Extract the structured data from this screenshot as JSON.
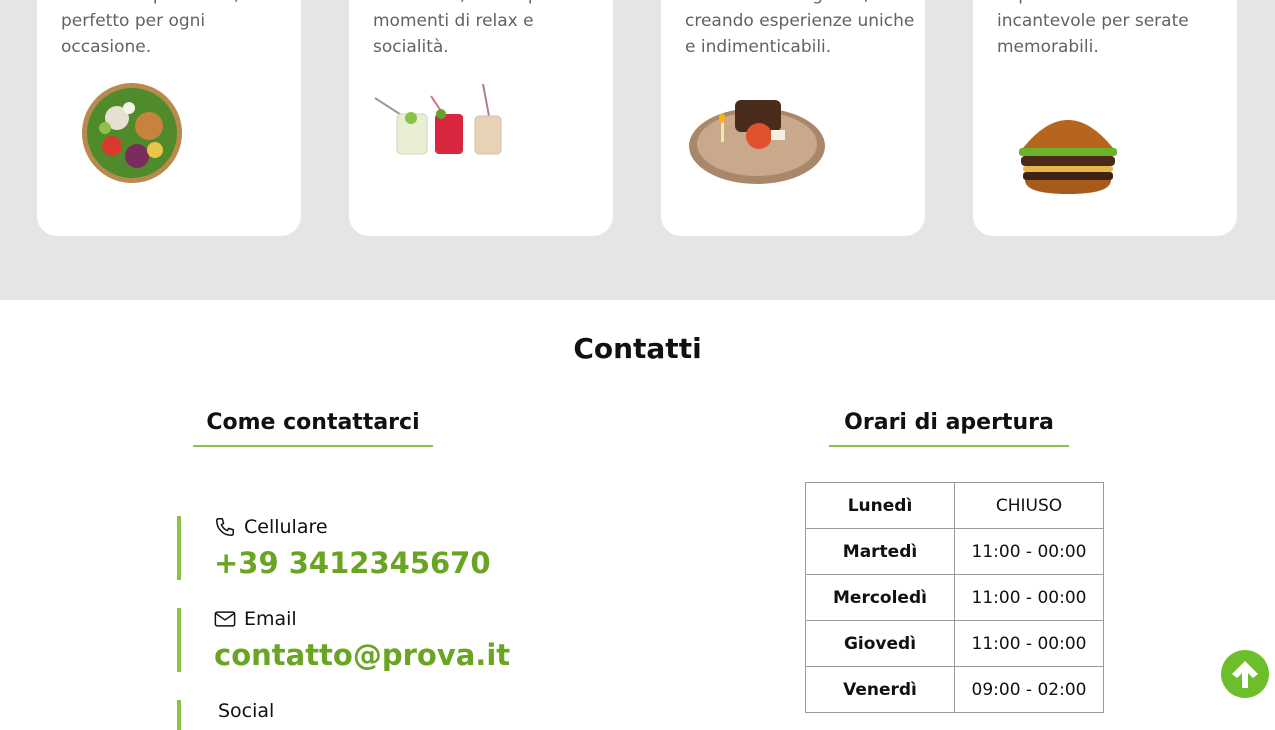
{
  "services": {
    "cards": [
      {
        "text": "servizio impeccabile, perfetto per ogni occasione.",
        "image": "salad-bowl"
      },
      {
        "text": "sofisticata, ideale per momenti di relax e socialità.",
        "image": "three-cocktails"
      },
      {
        "text": "attento alle esigenze, creando esperienze uniche e indimenticabili.",
        "image": "dessert-plate"
      },
      {
        "text": "impeccabile e ambiente incantevole per serate memorabili.",
        "image": "burger"
      }
    ]
  },
  "contacts": {
    "title": "Contatti",
    "how_to_contact": "Come contattarci",
    "phone_label": "Cellulare",
    "phone_value": "+39 3412345670",
    "email_label": "Email",
    "email_value": "contatto@prova.it",
    "social_label": "Social"
  },
  "hours": {
    "title": "Orari di apertura",
    "rows": [
      {
        "day": "Lunedì",
        "time": "CHIUSO"
      },
      {
        "day": "Martedì",
        "time": "11:00 - 00:00"
      },
      {
        "day": "Mercoledì",
        "time": "11:00 - 00:00"
      },
      {
        "day": "Giovedì",
        "time": "11:00 - 00:00"
      },
      {
        "day": "Venerdì",
        "time": "09:00 - 02:00"
      }
    ]
  },
  "colors": {
    "accent": "#8bc34a",
    "link_green": "#6aa423",
    "band_gray": "#e5e5e5",
    "scroll_button": "#6cbf2b"
  },
  "icons": {
    "phone": "phone-icon",
    "email": "envelope-icon",
    "scroll_top": "arrow-up-icon"
  }
}
